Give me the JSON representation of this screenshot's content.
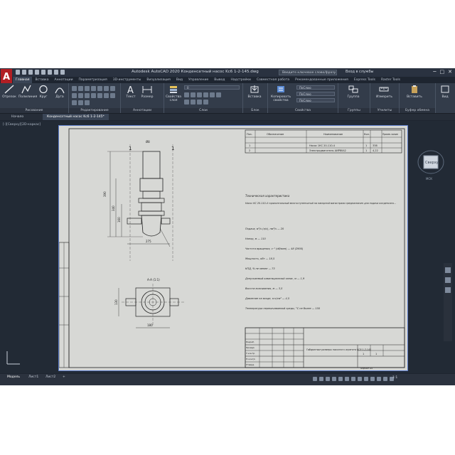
{
  "app": {
    "title": "Autodesk AutoCAD 2020  Конденсатный насос Kc6 1-2-145.dwg",
    "logo": "A",
    "search_placeholder": "Введите ключевое слово/фразу",
    "signin": "Вход в службы",
    "window_buttons": [
      "─",
      "□",
      "✕"
    ]
  },
  "ribbon_tabs": [
    "Главная",
    "Вставка",
    "Аннотации",
    "Параметризация",
    "3D-инструменты",
    "Визуализация",
    "Вид",
    "Управление",
    "Вывод",
    "Надстройки",
    "Совместная работа",
    "Рекомендованные приложения",
    "Express Tools",
    "Raster Tools"
  ],
  "ribbon": {
    "draw_tools": [
      "Отрезок",
      "Полилиния",
      "Круг",
      "Дуга"
    ],
    "draw_panel": "Рисование",
    "modify_panel": "Редактирование",
    "annotation_tools": [
      "Текст",
      "Размер"
    ],
    "annotation_panel": "Аннотации",
    "layer_combo": "0",
    "layer_props": "Свойства слоя",
    "layers_panel": "Слои",
    "insert_label": "Вставка",
    "block_panel": "Блок",
    "match_props": "Копировать свойства",
    "bylayer_1": "ПоСлою",
    "bylayer_2": "ПоСлою",
    "bylayer_3": "ПоСлою",
    "properties_panel": "Свойства",
    "group_label": "Группа",
    "groups_panel": "Группы",
    "measure_label": "Измерить",
    "utilities_panel": "Утилиты",
    "paste_label": "Вставить",
    "clipboard_panel": "Буфер обмена",
    "view_label": "Вид"
  },
  "doc_tabs": [
    "Начало",
    "Конденсатный насос Kc6 1-2-145*"
  ],
  "viewport_label": "[-][Сверху][2D-каркас]",
  "viewcube": {
    "face": "Сверху",
    "wcs": "МСК"
  },
  "table": {
    "headers": [
      "Поз.",
      "Обозначение",
      "Наименование",
      "Кол.",
      "Приме-чание"
    ],
    "rows": [
      {
        "pos": "1",
        "name": "Насос 1КС 20-110-4",
        "qty": "1",
        "mass": "338"
      },
      {
        "pos": "2",
        "name": "Электродвигатель АИР80А2",
        "qty": "1",
        "mass": "4,22"
      }
    ]
  },
  "specs": {
    "heading": "Техническая характеристика",
    "intro": "Насос КС 20-110-4 горизонтальный многоступенчатый на напорной магистрали предназначен для подачи конденсата...",
    "lines": [
      "Подача, м³/ч (л/с), нм³/ч — 20",
      "Напор, м — 110",
      "Частота вращения, с⁻¹ (об/мин) — 48 (2900)",
      "Мощность, кВт — 18,5",
      "КПД, % не менее — 73",
      "Допускаемый кавитационный запас, м — 1,9",
      "Высота всасывания, м — 3,5",
      "Давление на входе, кгс/см² — 4,5",
      "Температура перекачиваемой среды, °С не более — 150"
    ]
  },
  "drawing": {
    "pos_label_1": "1",
    "pos_label_2": "1",
    "top_label": "Ø8",
    "dim_h1": "390",
    "dim_h2": "340",
    "dim_h3": "160",
    "dim_w": "275",
    "view_label": "А-А (1:1)",
    "dim_side": "130",
    "dim_bottom": "180"
  },
  "title_block": {
    "doc_title": "Габаритные размеры насосного агрегата КС6 1-2-145",
    "sheet": "1",
    "sheets": "1",
    "format": "Формат А4",
    "rows": [
      "Разраб.",
      "Провер.",
      "Т.контр.",
      "Н.контр.",
      "Утверд."
    ]
  },
  "status": {
    "tabs": [
      "Модель",
      "Лист1",
      "Лист2",
      "+"
    ],
    "scale": "1:1"
  }
}
